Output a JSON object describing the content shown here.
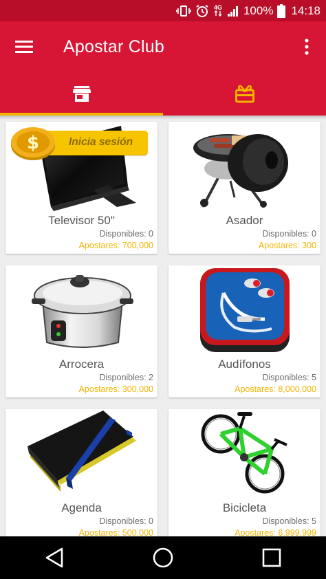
{
  "status_bar": {
    "network": "4G",
    "battery": "100%",
    "time": "14:18"
  },
  "app_bar": {
    "title": "Apostar Club"
  },
  "tabs": [
    {
      "icon": "store-icon",
      "active": true
    },
    {
      "icon": "gift-card-icon",
      "active": false
    }
  ],
  "login_badge": "Inicia sesión",
  "products": [
    {
      "name": "Televisor 50\"",
      "available": "Disponibles: 0",
      "price": "Apostares: 700,000",
      "icon": "tv-icon"
    },
    {
      "name": "Asador",
      "available": "Disponibles: 0",
      "price": "Apostares: 300",
      "icon": "grill-icon"
    },
    {
      "name": "Arrocera",
      "available": "Disponibles: 2",
      "price": "Apostares: 300,000",
      "icon": "rice-cooker-icon"
    },
    {
      "name": "Audífonos",
      "available": "Disponibles: 5",
      "price": "Apostares: 8,000,000",
      "icon": "earphones-icon"
    },
    {
      "name": "Agenda",
      "available": "Disponibles: 0",
      "price": "Apostares: 500,000",
      "icon": "notebook-icon"
    },
    {
      "name": "Bicicleta",
      "available": "Disponibles: 5",
      "price": "Apostares: 6,999,999",
      "icon": "bicycle-icon"
    }
  ],
  "colors": {
    "status_bar": "#b80e2a",
    "primary": "#d71535",
    "accent": "#f5b400",
    "price_text": "#f2b400",
    "background": "#eeeeee"
  }
}
